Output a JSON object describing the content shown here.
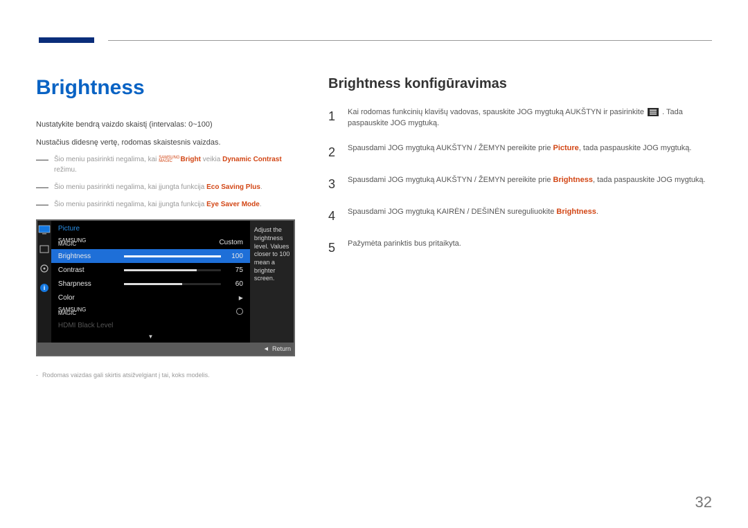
{
  "header": {
    "accent": "#0a2d7a"
  },
  "left": {
    "title": "Brightness",
    "desc1": "Nustatykite bendrą vaizdo skaistį (intervalas: 0~100)",
    "desc2": "Nustačius didesnę vertę, rodomas skaistesnis vaizdas.",
    "note1_pre": "Šio meniu pasirinkti negalima, kai ",
    "note1_stack_top": "SAMSUNG",
    "note1_stack_bot": "MAGIC",
    "note1_bright": "Bright",
    "note1_mid": " veikia ",
    "note1_dc": "Dynamic Contrast",
    "note1_post": " režimu.",
    "note2_pre": "Šio meniu pasirinkti negalima, kai įjungta funkcija ",
    "note2_em": "Eco Saving Plus",
    "note3_pre": "Šio meniu pasirinkti negalima, kai įjungta funkcija ",
    "note3_em": "Eye Saver Mode",
    "footnote": "Rodomas vaizdas gali skirtis atsižvelgiant į tai, koks modelis."
  },
  "osd": {
    "title": "Picture",
    "r1": {
      "label_top": "SAMSUNG",
      "label_bot": "MAGIC",
      "right": "Custom"
    },
    "r2": {
      "label": "Brightness",
      "value": "100",
      "fill": 100
    },
    "r3": {
      "label": "Contrast",
      "value": "75",
      "fill": 75
    },
    "r4": {
      "label": "Sharpness",
      "value": "60",
      "fill": 60
    },
    "r5": {
      "label": "Color"
    },
    "r6": {
      "label_top": "SAMSUNG",
      "label_bot": "MAGIC"
    },
    "r7": {
      "label": "HDMI Black Level"
    },
    "tip": "Adjust the brightness level. Values closer to 100 mean a brighter screen.",
    "footer": "Return"
  },
  "right": {
    "title": "Brightness konfigūravimas",
    "s1_a": "Kai rodomas funkcinių klavišų vadovas, spauskite JOG mygtuką AUKŠTYN ir pasirinkite ",
    "s1_b": ". Tada paspauskite JOG mygtuką.",
    "s2_a": "Spausdami JOG mygtuką AUKŠTYN / ŽEMYN pereikite prie ",
    "s2_em": "Picture",
    "s2_b": ", tada paspauskite JOG mygtuką.",
    "s3_a": "Spausdami JOG mygtuką AUKŠTYN / ŽEMYN pereikite prie ",
    "s3_em": "Brightness",
    "s3_b": ", tada paspauskite JOG mygtuką.",
    "s4_a": "Spausdami JOG mygtuką KAIRĖN / DEŠINĖN sureguliuokite ",
    "s4_em": "Brightness",
    "s5": "Pažymėta parinktis bus pritaikyta."
  },
  "pageNumber": "32"
}
